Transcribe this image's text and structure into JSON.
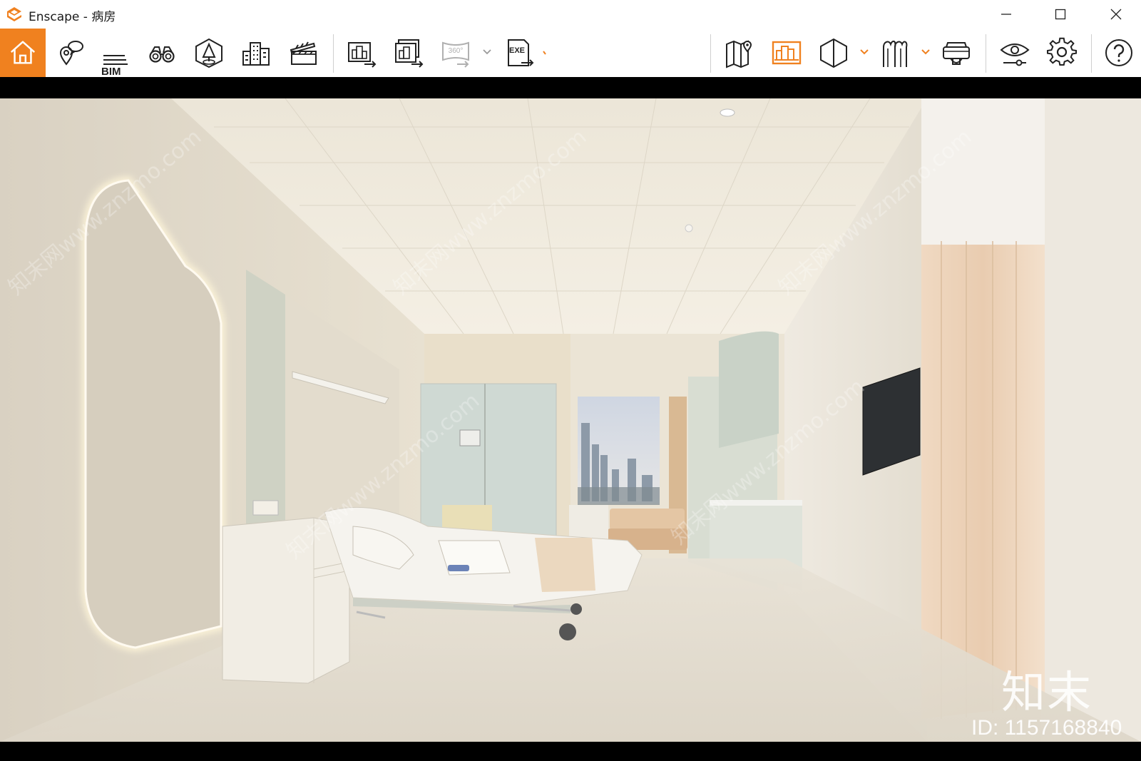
{
  "window": {
    "app_name": "Enscape",
    "title": "Enscape - 病房",
    "accent_color": "#f0811f"
  },
  "toolbar": {
    "buttons": [
      {
        "name": "home",
        "icon": "home-icon",
        "active": true
      },
      {
        "name": "views",
        "icon": "location-bubble-icon"
      },
      {
        "name": "bim",
        "icon": "bim-icon",
        "label": "BIM"
      },
      {
        "name": "binoculars",
        "icon": "binoculars-icon"
      },
      {
        "name": "asset-library",
        "icon": "asset-library-icon"
      },
      {
        "name": "site-context",
        "icon": "buildings-icon"
      },
      {
        "name": "video-editor",
        "icon": "clapperboard-icon"
      },
      {
        "name": "screenshot-export",
        "icon": "image-export-icon"
      },
      {
        "name": "batch-export",
        "icon": "batch-export-icon"
      },
      {
        "name": "panorama-export",
        "icon": "panorama-360-icon",
        "label": "360°",
        "disabled": true
      },
      {
        "name": "exe-export",
        "icon": "exe-export-icon",
        "label": "EXE"
      },
      {
        "name": "map",
        "icon": "map-icon"
      },
      {
        "name": "render-settings",
        "icon": "render-settings-icon",
        "active": true
      },
      {
        "name": "section-box",
        "icon": "cube-icon"
      },
      {
        "name": "outline",
        "icon": "outline-icon"
      },
      {
        "name": "vr-headset",
        "icon": "vr-headset-icon"
      },
      {
        "name": "visual-settings",
        "icon": "eye-icon"
      },
      {
        "name": "settings",
        "icon": "gear-icon"
      },
      {
        "name": "help",
        "icon": "help-icon"
      }
    ]
  },
  "viewport": {
    "scene": "hospital-ward-render",
    "watermark_brand": "知末",
    "watermark_id": "ID: 1157168840",
    "watermark_diagonal": "知末网www.znzmo.com"
  }
}
